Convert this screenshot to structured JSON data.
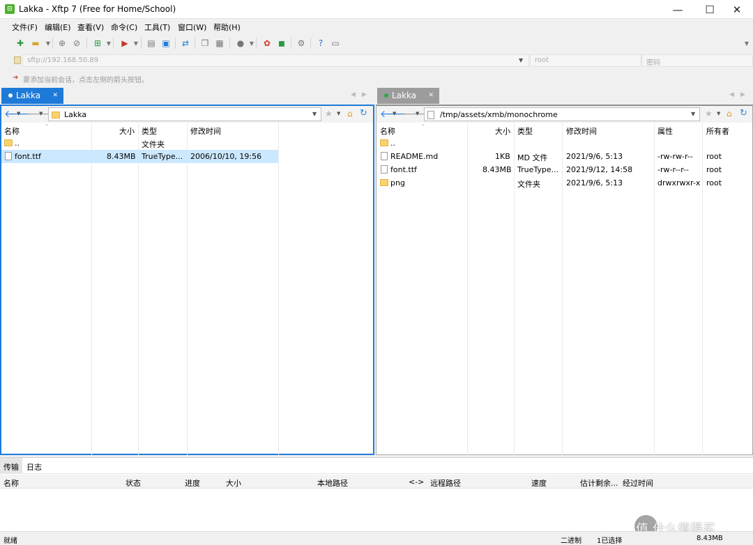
{
  "app": {
    "title": "Lakka - Xftp 7 (Free for Home/School)",
    "icon_glyph": "⊡",
    "accent": "#1e7ad8",
    "status_dot_local": "#1e7ad8",
    "status_dot_remote": "#2aa84a"
  },
  "window_controls": {
    "minimize": "—",
    "maximize": "☐",
    "close": "✕"
  },
  "menu": [
    "文件(F)",
    "编辑(E)",
    "查看(V)",
    "命令(C)",
    "工具(T)",
    "窗口(W)",
    "帮助(H)"
  ],
  "connection": {
    "host": "sftp://192.168.50.89",
    "user_placeholder": "root",
    "password_placeholder": "密码",
    "hint": "要添加当前会话，点击左侧的箭头按钮。"
  },
  "local": {
    "tab_label": "Lakka",
    "path": "Lakka",
    "columns": [
      "名称",
      "大小",
      "类型",
      "修改时间"
    ],
    "rows": [
      {
        "name": "..",
        "size": "",
        "type": "文件夹",
        "modified": "",
        "icon": "folder-icon"
      },
      {
        "name": "font.ttf",
        "size": "8.43MB",
        "type": "TrueType...",
        "modified": "2006/10/10, 19:56",
        "icon": "file-icon"
      }
    ]
  },
  "remote": {
    "tab_label": "Lakka",
    "path": "/tmp/assets/xmb/monochrome",
    "columns": [
      "名称",
      "大小",
      "类型",
      "修改时间",
      "属性",
      "所有者"
    ],
    "rows": [
      {
        "name": "..",
        "size": "",
        "type": "",
        "modified": "",
        "attr": "",
        "owner": "",
        "icon": "folder-icon"
      },
      {
        "name": "README.md",
        "size": "1KB",
        "type": "MD 文件",
        "modified": "2021/9/6, 5:13",
        "attr": "-rw-rw-r--",
        "owner": "root",
        "icon": "file-icon"
      },
      {
        "name": "font.ttf",
        "size": "8.43MB",
        "type": "TrueType...",
        "modified": "2021/9/12, 14:58",
        "attr": "-rw-r--r--",
        "owner": "root",
        "icon": "file-icon"
      },
      {
        "name": "png",
        "size": "",
        "type": "文件夹",
        "modified": "2021/9/6, 5:13",
        "attr": "drwxrwxr-x",
        "owner": "root",
        "icon": "folder-icon"
      }
    ]
  },
  "transfer": {
    "tabs": [
      "传输",
      "日志"
    ],
    "columns": [
      "名称",
      "状态",
      "进度",
      "大小",
      "本地路径",
      "<->",
      "远程路径",
      "速度",
      "估计剩余...",
      "经过时间"
    ]
  },
  "status": {
    "left": "就绪",
    "mode": "二进制",
    "selected": "1已选择",
    "size": "8.43MB"
  },
  "watermark": "值 什么值得买"
}
